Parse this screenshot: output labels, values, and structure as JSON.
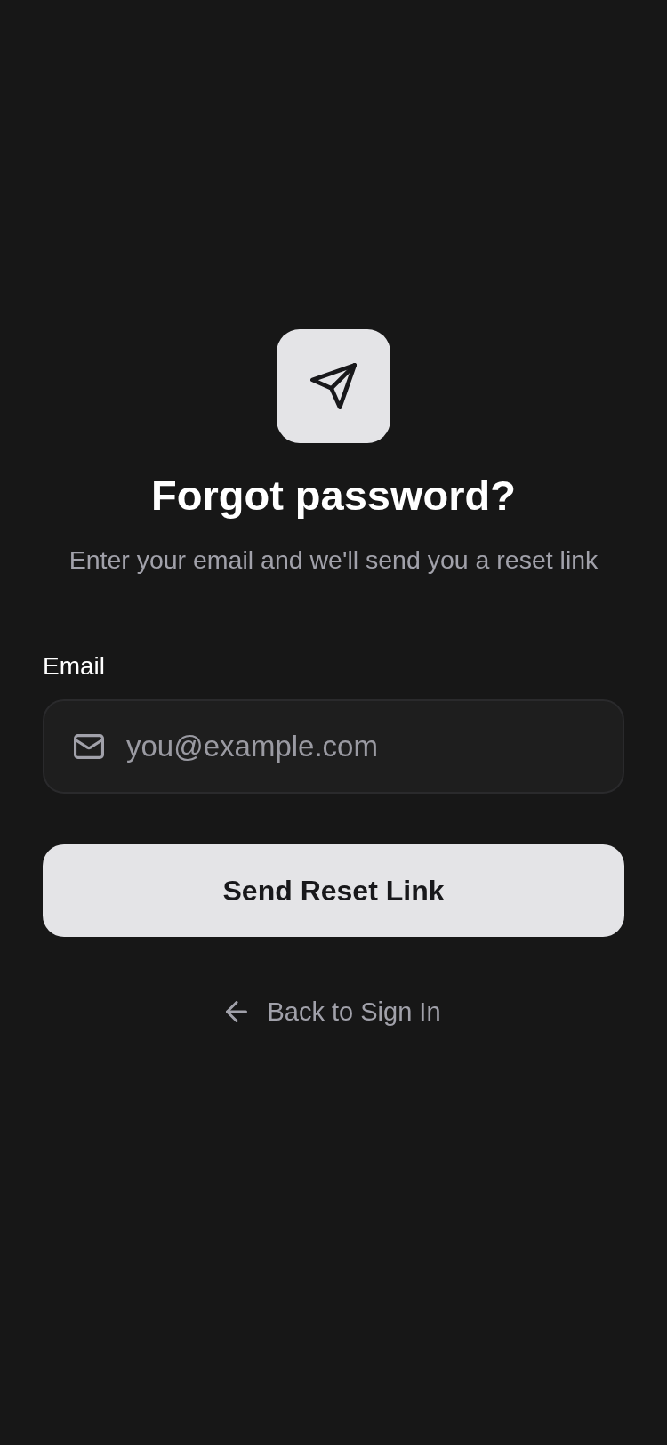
{
  "header": {
    "title": "Forgot password?",
    "subtitle": "Enter your email and we'll send you a reset link"
  },
  "form": {
    "fields": [
      {
        "kind": "email",
        "label": "Email",
        "placeholder": "you@example.com"
      }
    ],
    "submit": {
      "label": "Send Reset Link"
    }
  },
  "back_link": {
    "label": "Back to Sign In"
  }
}
